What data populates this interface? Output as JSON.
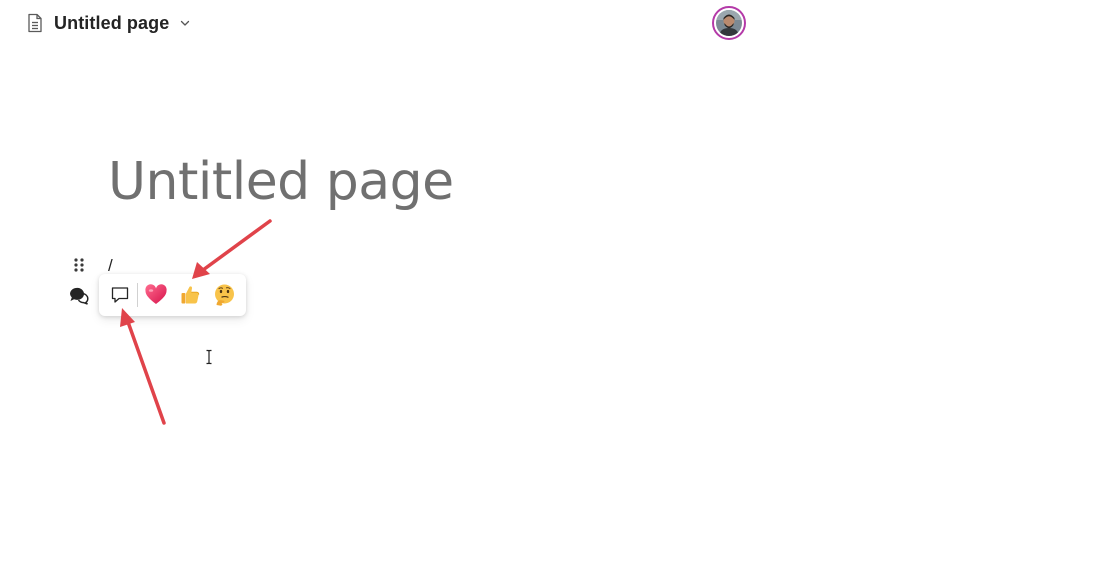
{
  "topbar": {
    "page_title": "Untitled page",
    "doc_icon": "document-icon",
    "chevron_icon": "chevron-down-icon"
  },
  "user": {
    "avatar_icon": "user-avatar",
    "ring_color": "#b43aa8"
  },
  "page": {
    "heading": "Untitled page",
    "block_text": "/"
  },
  "block_controls": {
    "drag_handle_icon": "drag-handle-icon",
    "comments_icon": "comments-icon"
  },
  "reaction_bar": {
    "items": [
      {
        "name": "comment",
        "icon": "comment-icon"
      },
      {
        "name": "heart",
        "icon": "heart-emoji-icon"
      },
      {
        "name": "thumbs-up",
        "icon": "thumbs-up-emoji-icon"
      },
      {
        "name": "thinking",
        "icon": "thinking-face-emoji-icon"
      }
    ]
  },
  "annotations": {
    "arrow_color": "#e0434a",
    "arrows": [
      "arrow-to-thumbs-up",
      "arrow-to-comment-button"
    ]
  },
  "colors": {
    "heading": "#707070",
    "text": "#242424"
  }
}
